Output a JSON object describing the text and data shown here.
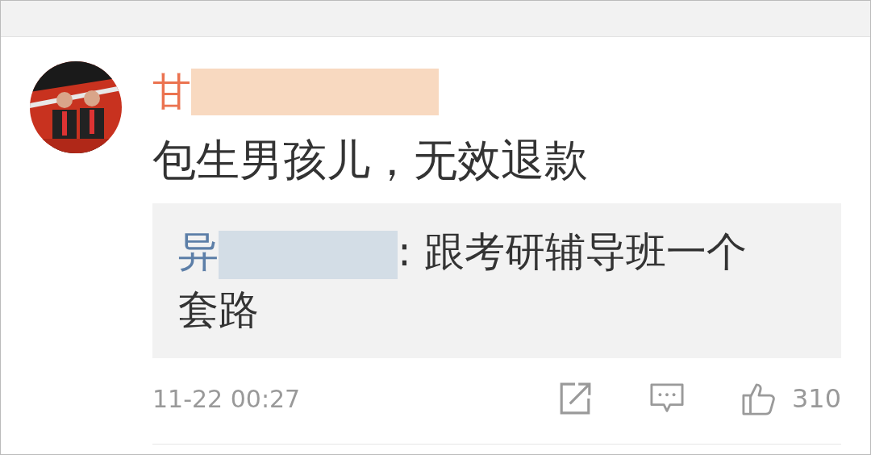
{
  "comment": {
    "author": "甘",
    "text": "包生男孩儿，无效退款",
    "reply": {
      "author": "异",
      "text": ": 跟考研辅导班一个套路"
    },
    "time": "11-22 00:27",
    "likes": "310"
  }
}
